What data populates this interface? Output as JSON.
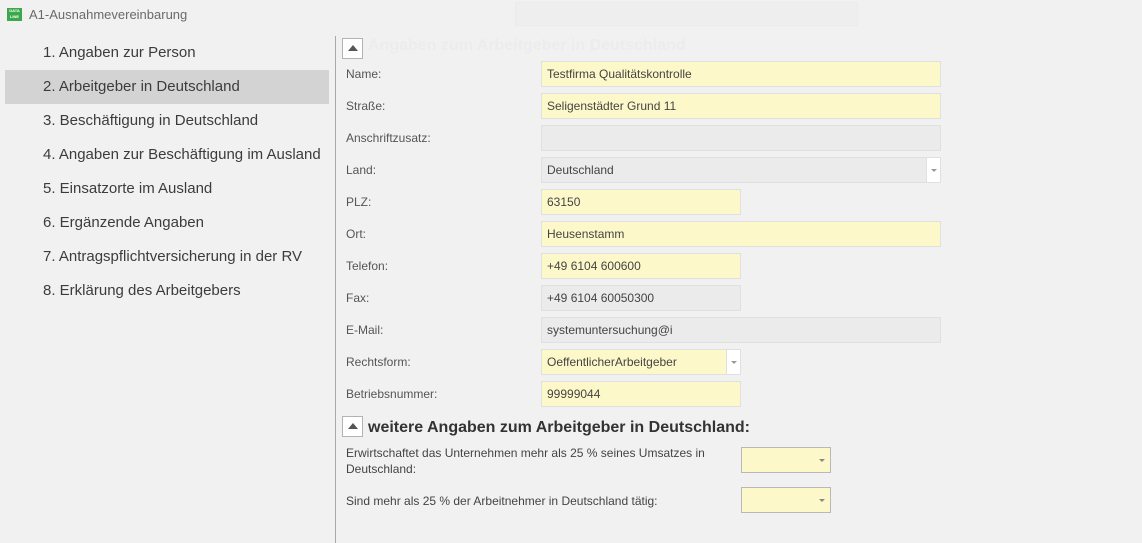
{
  "window": {
    "title": "A1-Ausnahmevereinbarung",
    "logo_text": "DATA LINE"
  },
  "nav": {
    "items": [
      {
        "label": "1. Angaben zur Person"
      },
      {
        "label": "2. Arbeitgeber in Deutschland",
        "active": true
      },
      {
        "label": "3. Beschäftigung in Deutschland"
      },
      {
        "label": "4. Angaben zur Beschäftigung im Ausland"
      },
      {
        "label": "5. Einsatzorte im Ausland"
      },
      {
        "label": "6. Ergänzende Angaben"
      },
      {
        "label": "7. Antragspflichtversicherung in der RV"
      },
      {
        "label": "8. Erklärung des Arbeitgebers"
      }
    ]
  },
  "section1": {
    "title": "Angaben zum Arbeitgeber in Deutschland"
  },
  "fields": {
    "name": {
      "label": "Name:",
      "value": "Testfirma Qualitätskontrolle"
    },
    "strasse": {
      "label": "Straße:",
      "value": "Seligenstädter Grund 11"
    },
    "anschriftzusatz": {
      "label": "Anschriftzusatz:",
      "value": ""
    },
    "land": {
      "label": "Land:",
      "value": "Deutschland"
    },
    "plz": {
      "label": "PLZ:",
      "value": "63150"
    },
    "ort": {
      "label": "Ort:",
      "value": "Heusenstamm"
    },
    "telefon": {
      "label": "Telefon:",
      "value": "+49 6104 600600"
    },
    "fax": {
      "label": "Fax:",
      "value": "+49 6104 60050300"
    },
    "email": {
      "label": "E-Mail:",
      "value": "systemuntersuchung@i"
    },
    "rechtsform": {
      "label": "Rechtsform:",
      "value": "OeffentlicherArbeitgeber"
    },
    "betriebsnummer": {
      "label": "Betriebsnummer:",
      "value": "99999044"
    }
  },
  "section2": {
    "title": "weitere Angaben zum Arbeitgeber in Deutschland:",
    "q1": {
      "label": "Erwirtschaftet das Unternehmen mehr als 25 % seines Umsatzes in Deutschland:",
      "value": ""
    },
    "q2": {
      "label": "Sind mehr als 25 % der Arbeitnehmer in Deutschland tätig:",
      "value": ""
    }
  },
  "colors": {
    "required_field": "#fdf8c9",
    "readonly_field": "#ebebeb",
    "active_nav": "#d3d3d3",
    "brand": "#3aa84b"
  }
}
